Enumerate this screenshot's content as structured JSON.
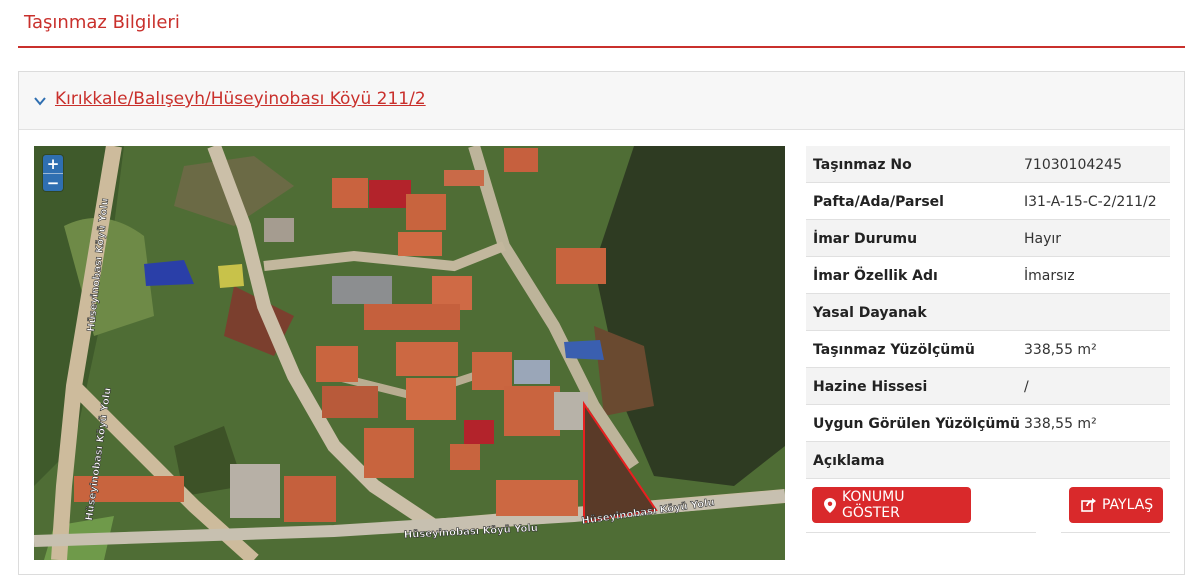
{
  "header": {
    "title": "Taşınmaz Bilgileri"
  },
  "panel": {
    "title": "Kırıkkale/Balışeyh/Hüseyinobası Köyü 211/2"
  },
  "map": {
    "zoom_in": "+",
    "zoom_out": "−",
    "road_labels": [
      "Hüseyinobası Köyü Yolu",
      "Hüseyinobası Köyü Yolu",
      "Hüseyinobası Köyü Yolu",
      "Hüseyinobası Köyü Yolu"
    ]
  },
  "info": {
    "rows": [
      {
        "key": "Taşınmaz No",
        "value": "71030104245"
      },
      {
        "key": "Pafta/Ada/Parsel",
        "value": "I31-A-15-C-2/211/2"
      },
      {
        "key": "İmar Durumu",
        "value": "Hayır"
      },
      {
        "key": "İmar Özellik Adı",
        "value": "İmarsız"
      },
      {
        "key": "Yasal Dayanak",
        "value": ""
      },
      {
        "key": "Taşınmaz Yüzölçümü",
        "value": "338,55 m²"
      },
      {
        "key": "Hazine Hissesi",
        "value": "/"
      },
      {
        "key": "Uygun Görülen Yüzölçümü",
        "value": "338,55 m²"
      },
      {
        "key": "Açıklama",
        "value": ""
      }
    ]
  },
  "actions": {
    "locate_label": "KONUMU GÖSTER",
    "share_label": "PAYLAŞ"
  },
  "colors": {
    "accent": "#c9302c",
    "button": "#d9292b",
    "zoom": "#2f6fb1"
  },
  "icons": {
    "collapse": "chevron-down-icon",
    "locate": "map-marker-icon",
    "share": "share-icon"
  }
}
